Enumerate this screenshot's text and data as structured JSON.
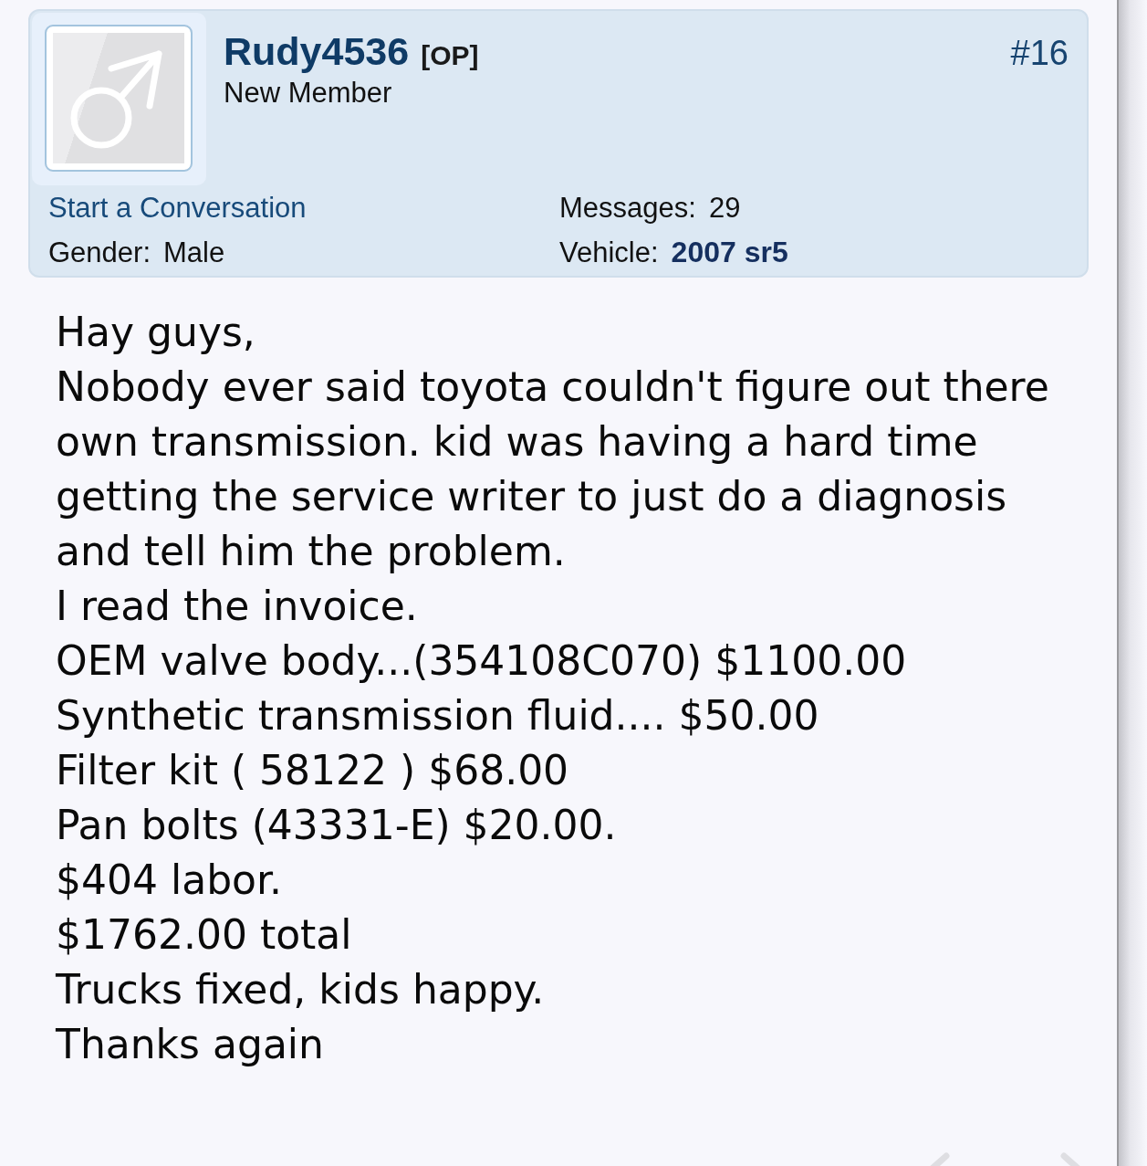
{
  "post": {
    "author": {
      "username": "Rudy4536",
      "badge": "[OP]",
      "title": "New Member"
    },
    "post_number": "#16",
    "details_left": [
      {
        "kind": "link",
        "text": "Start a Conversation"
      },
      {
        "kind": "field",
        "label": "Gender:",
        "value": "Male"
      }
    ],
    "details_right": [
      {
        "kind": "field",
        "label": "Messages:",
        "value": "29"
      },
      {
        "kind": "field_link",
        "label": "Vehicle:",
        "value": "2007 sr5"
      }
    ],
    "body": [
      "Hay guys,",
      "Nobody ever said toyota couldn't figure out there own transmission. kid was having a hard time getting the service writer to just do a diagnosis and tell him the problem.",
      "I read the invoice.",
      "OEM valve body...(354108C070) $1100.00",
      "Synthetic transmission fluid.... $50.00",
      "Filter kit ( 58122 ) $68.00",
      "Pan bolts (43331-E) $20.00.",
      "$404 labor.",
      "$1762.00 total",
      "Trucks fixed, kids happy.",
      "Thanks again"
    ]
  }
}
